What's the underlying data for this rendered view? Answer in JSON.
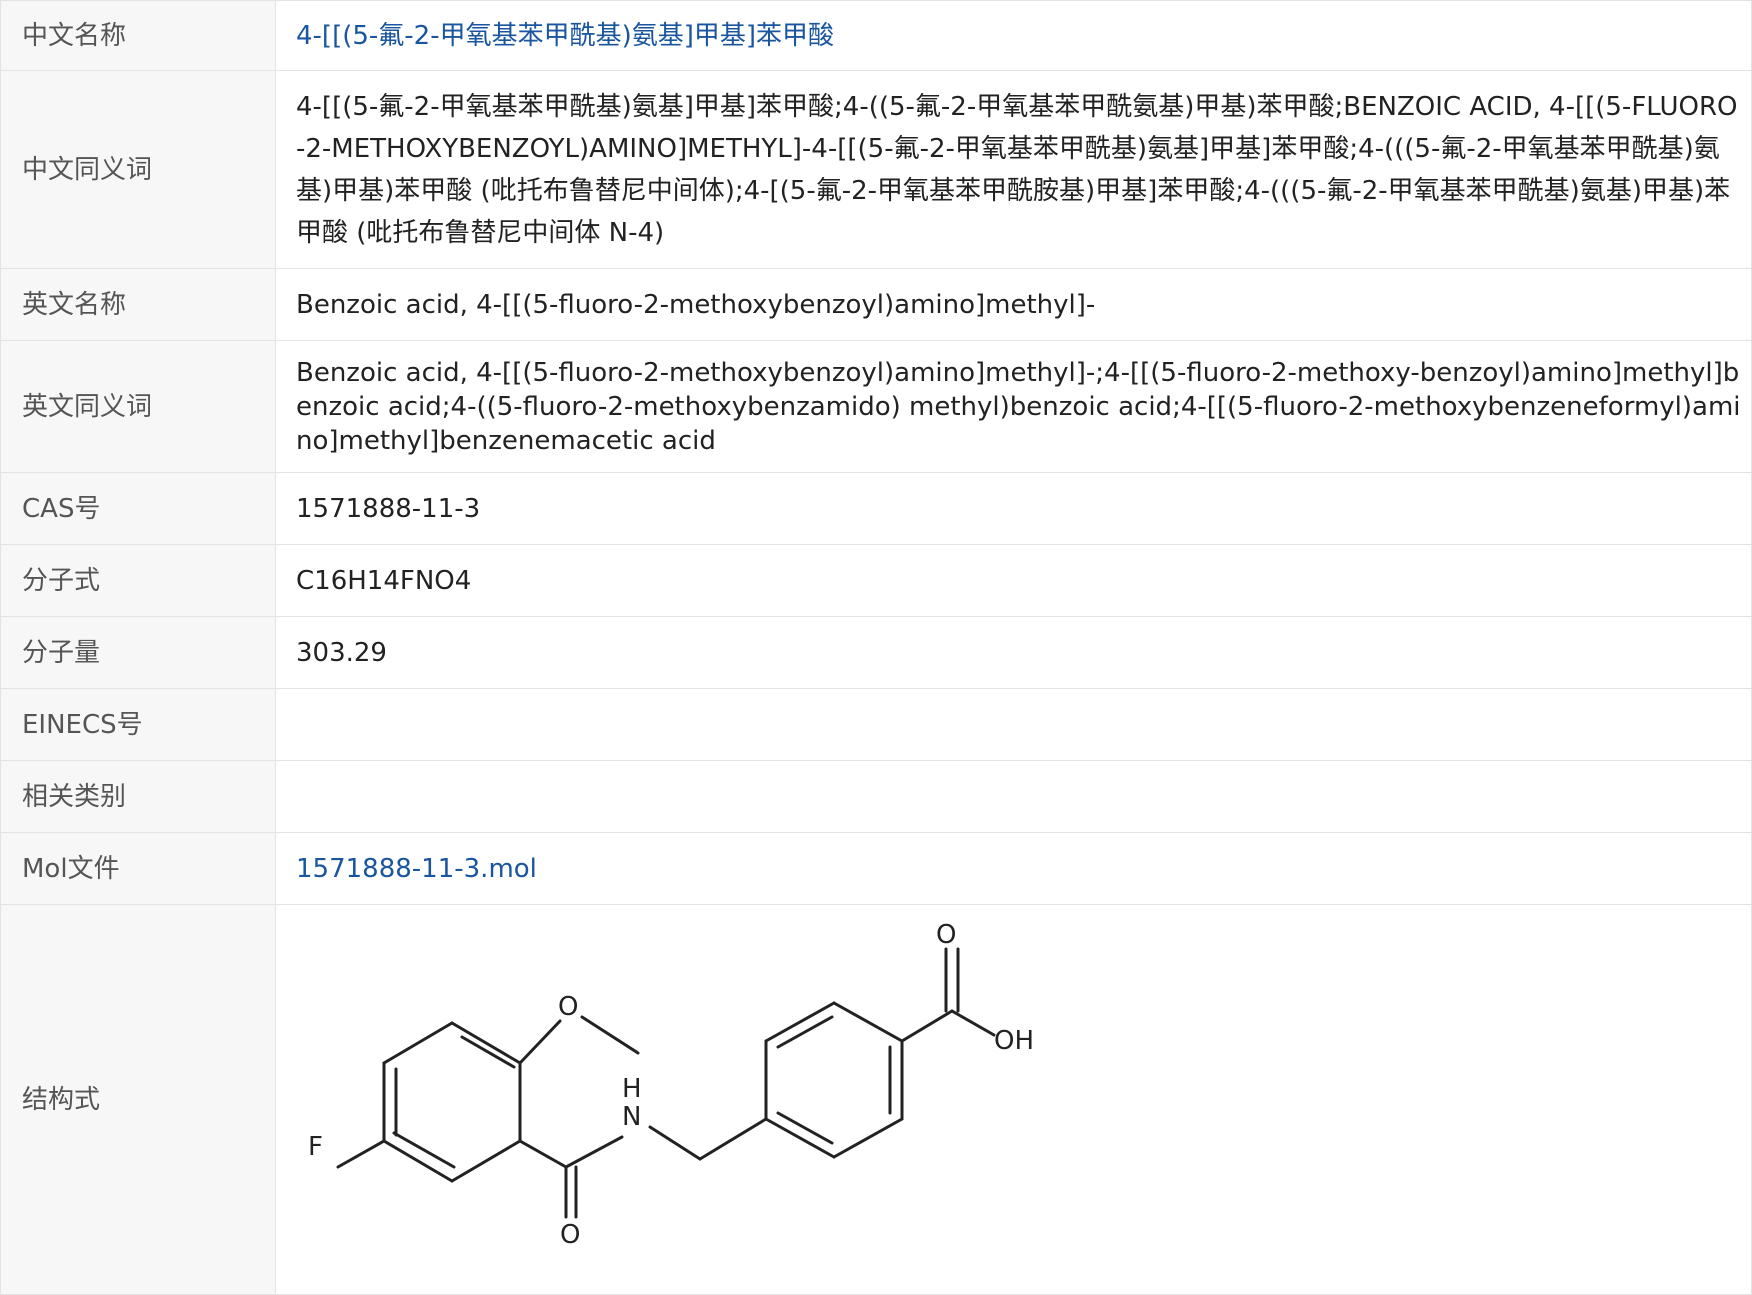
{
  "rows": [
    {
      "label": "中文名称",
      "value": "4-[[(5-氟-2-甲氧基苯甲酰基)氨基]甲基]苯甲酸"
    },
    {
      "label": "中文同义词",
      "value": "4-[[(5-氟-2-甲氧基苯甲酰基)氨基]甲基]苯甲酸;4-((5-氟-2-甲氧基苯甲酰氨基)甲基)苯甲酸;BENZOIC ACID, 4-[[(5-FLUORO-2-METHOXYBENZOYL)AMINO]METHYL]-4-[[(5-氟-2-甲氧基苯甲酰基)氨基]甲基]苯甲酸;4-(((5-氟-2-甲氧基苯甲酰基)氨基)甲基)苯甲酸 (吡托布鲁替尼中间体);4-[(5-氟-2-甲氧基苯甲酰胺基)甲基]苯甲酸;4-(((5-氟-2-甲氧基苯甲酰基)氨基)甲基)苯甲酸 (吡托布鲁替尼中间体 N-4)"
    },
    {
      "label": "英文名称",
      "value": "Benzoic acid, 4-[[(5-fluoro-2-methoxybenzoyl)amino]methyl]-"
    },
    {
      "label": "英文同义词",
      "value": "Benzoic acid, 4-[[(5-fluoro-2-methoxybenzoyl)amino]methyl]-;4-[[(5-fluoro-2-methoxy-benzoyl)amino]methyl]benzoic acid;4-((5-fluoro-2-methoxybenzamido) methyl)benzoic acid;4-[[(5-fluoro-2-methoxybenzeneformyl)amino]methyl]benzenemacetic acid"
    },
    {
      "label": "CAS号",
      "value": "1571888-11-3"
    },
    {
      "label": "分子式",
      "value": "C16H14FNO4"
    },
    {
      "label": "分子量",
      "value": "303.29"
    },
    {
      "label": "EINECS号",
      "value": ""
    },
    {
      "label": "相关类别",
      "value": ""
    },
    {
      "label": "Mol文件",
      "value": "1571888-11-3.mol"
    },
    {
      "label": "结构式",
      "value": ""
    }
  ],
  "structure": {
    "atoms": {
      "O_top": "O",
      "OH": "OH",
      "O_methoxy": "O",
      "N": "N",
      "H": "H",
      "F": "F",
      "O_bottom": "O"
    }
  },
  "colors": {
    "link": "#1a56a0",
    "label_bg": "#f7f7f7",
    "border": "#e3e3e3"
  }
}
